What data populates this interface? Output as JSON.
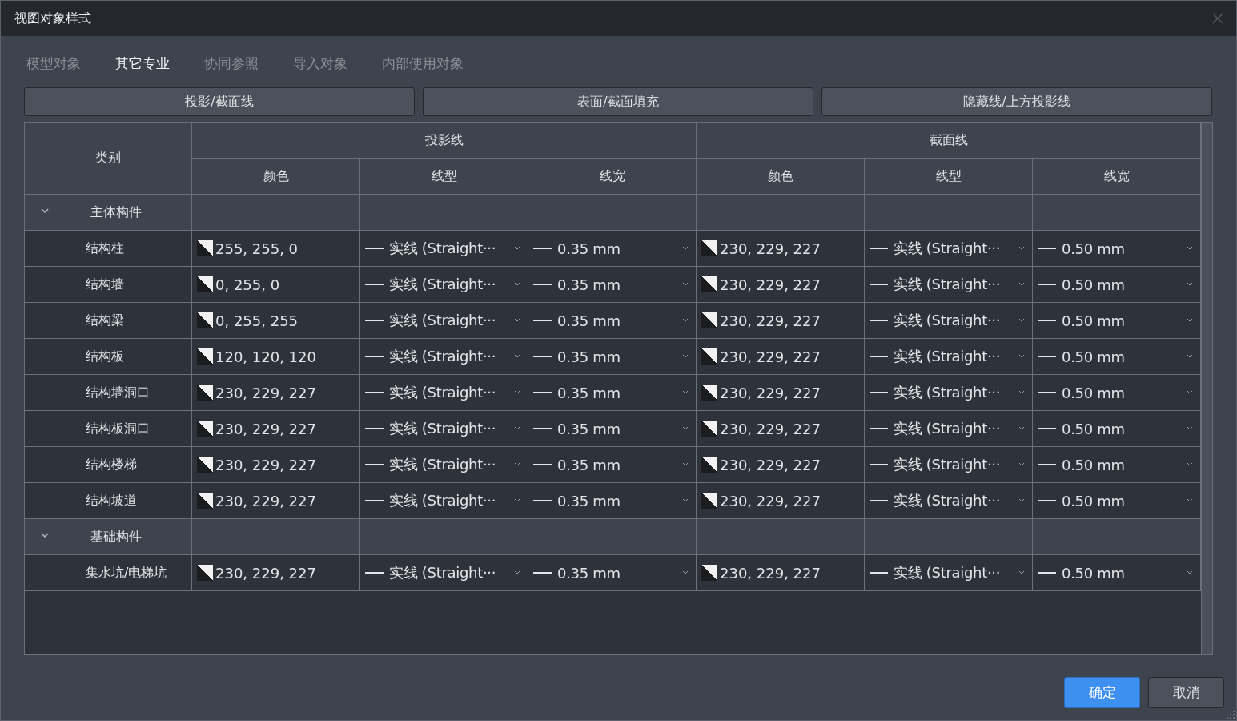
{
  "window": {
    "title": "视图对象样式"
  },
  "tabs": [
    {
      "label": "模型对象",
      "selected": false
    },
    {
      "label": "其它专业",
      "selected": true
    },
    {
      "label": "协同参照",
      "selected": false
    },
    {
      "label": "导入对象",
      "selected": false
    },
    {
      "label": "内部使用对象",
      "selected": false
    }
  ],
  "section_buttons": [
    "投影/截面线",
    "表面/截面填充",
    "隐藏线/上方投影线"
  ],
  "table": {
    "category_header": "类别",
    "column_groups": [
      {
        "label": "投影线",
        "columns": [
          "颜色",
          "线型",
          "线宽"
        ]
      },
      {
        "label": "截面线",
        "columns": [
          "颜色",
          "线型",
          "线宽"
        ]
      }
    ],
    "groups": [
      {
        "name": "主体构件",
        "expanded": true,
        "rows": [
          {
            "name": "结构柱",
            "cells": [
              "255, 255, 0",
              "实线 (Straight···",
              "0.35 mm",
              "230, 229, 227",
              "实线 (Straight···",
              "0.50 mm"
            ]
          },
          {
            "name": "结构墙",
            "cells": [
              "0, 255, 0",
              "实线 (Straight···",
              "0.35 mm",
              "230, 229, 227",
              "实线 (Straight···",
              "0.50 mm"
            ]
          },
          {
            "name": "结构梁",
            "cells": [
              "0, 255, 255",
              "实线 (Straight···",
              "0.35 mm",
              "230, 229, 227",
              "实线 (Straight···",
              "0.50 mm"
            ]
          },
          {
            "name": "结构板",
            "cells": [
              "120, 120, 120",
              "实线 (Straight···",
              "0.35 mm",
              "230, 229, 227",
              "实线 (Straight···",
              "0.50 mm"
            ]
          },
          {
            "name": "结构墙洞口",
            "cells": [
              "230, 229, 227",
              "实线 (Straight···",
              "0.35 mm",
              "230, 229, 227",
              "实线 (Straight···",
              "0.50 mm"
            ]
          },
          {
            "name": "结构板洞口",
            "cells": [
              "230, 229, 227",
              "实线 (Straight···",
              "0.35 mm",
              "230, 229, 227",
              "实线 (Straight···",
              "0.50 mm"
            ]
          },
          {
            "name": "结构楼梯",
            "cells": [
              "230, 229, 227",
              "实线 (Straight···",
              "0.35 mm",
              "230, 229, 227",
              "实线 (Straight···",
              "0.50 mm"
            ]
          },
          {
            "name": "结构坡道",
            "cells": [
              "230, 229, 227",
              "实线 (Straight···",
              "0.35 mm",
              "230, 229, 227",
              "实线 (Straight···",
              "0.50 mm"
            ]
          }
        ]
      },
      {
        "name": "基础构件",
        "expanded": true,
        "rows": [
          {
            "name": "集水坑/电梯坑",
            "cells": [
              "230, 229, 227",
              "实线 (Straight···",
              "0.35 mm",
              "230, 229, 227",
              "实线 (Straight···",
              "0.50 mm"
            ]
          }
        ]
      }
    ]
  },
  "footer_buttons": [
    {
      "label": "确定",
      "kind": "primary"
    },
    {
      "label": "取消",
      "kind": "secondary"
    }
  ]
}
